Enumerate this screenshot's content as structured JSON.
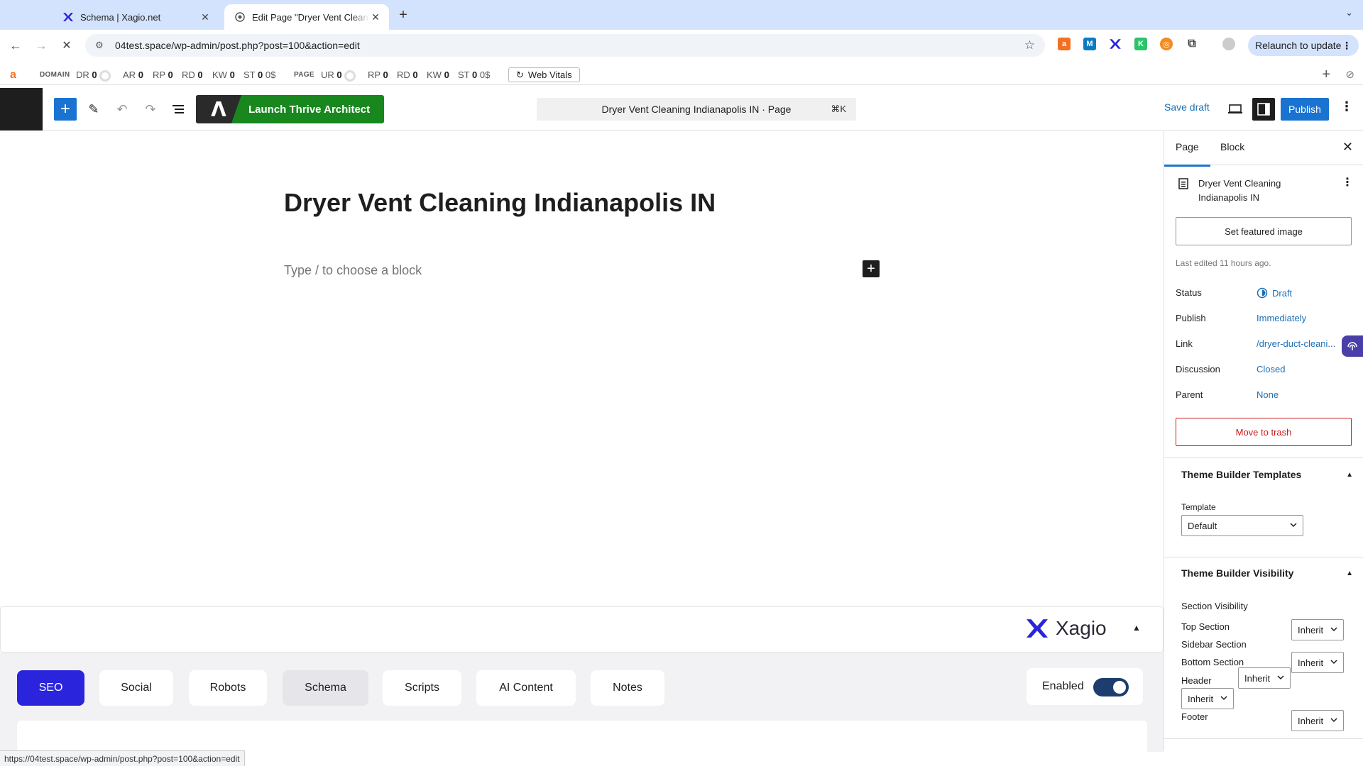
{
  "browser": {
    "tabs": [
      {
        "title": "Schema | Xagio.net",
        "active": false
      },
      {
        "title": "Edit Page \"Dryer Vent Cleaning Indianapolis IN\"",
        "active": true
      }
    ],
    "url": "04test.space/wp-admin/post.php?post=100&action=edit",
    "relaunch_label": "Relaunch to update",
    "status_url": "https://04test.space/wp-admin/post.php?post=100&action=edit"
  },
  "seobar": {
    "domain_label": "DOMAIN",
    "domain_metrics": [
      {
        "k": "DR",
        "v": "0"
      },
      {
        "k": "AR",
        "v": "0"
      },
      {
        "k": "RP",
        "v": "0"
      },
      {
        "k": "RD",
        "v": "0"
      },
      {
        "k": "KW",
        "v": "0"
      },
      {
        "k": "ST",
        "v": "0"
      },
      {
        "k": "",
        "v": "0$"
      }
    ],
    "page_label": "PAGE",
    "page_metrics": [
      {
        "k": "UR",
        "v": "0"
      },
      {
        "k": "RP",
        "v": "0"
      },
      {
        "k": "RD",
        "v": "0"
      },
      {
        "k": "KW",
        "v": "0"
      },
      {
        "k": "ST",
        "v": "0"
      },
      {
        "k": "",
        "v": "0$"
      }
    ],
    "web_vitals": "Web Vitals"
  },
  "editor": {
    "launch_thrive": "Launch Thrive Architect",
    "doc_title": "Dryer Vent Cleaning Indianapolis IN · Page",
    "shortcut": "⌘K",
    "save_draft": "Save draft",
    "publish": "Publish"
  },
  "content": {
    "title": "Dryer Vent Cleaning Indianapolis IN",
    "placeholder": "Type / to choose a block"
  },
  "xagio": {
    "brand": "Xagio",
    "tabs": [
      "SEO",
      "Social",
      "Robots",
      "Schema",
      "Scripts",
      "AI Content",
      "Notes"
    ],
    "selected_tab": "SEO",
    "enabled_label": "Enabled",
    "enabled": true,
    "accent": "#2a24dc"
  },
  "sidebar": {
    "tabs": [
      "Page",
      "Block"
    ],
    "page_name": "Dryer Vent Cleaning Indianapolis IN",
    "featured_image": "Set featured image",
    "last_edited": "Last edited 11 hours ago.",
    "props": [
      {
        "k": "Status",
        "v": "Draft"
      },
      {
        "k": "Publish",
        "v": "Immediately"
      },
      {
        "k": "Link",
        "v": "/dryer-duct-cleani..."
      },
      {
        "k": "Discussion",
        "v": "Closed"
      },
      {
        "k": "Parent",
        "v": "None"
      }
    ],
    "trash": "Move to trash",
    "theme_templates": {
      "heading": "Theme Builder Templates",
      "template_label": "Template",
      "template_value": "Default"
    },
    "theme_visibility": {
      "heading": "Theme Builder Visibility",
      "section_label": "Section Visibility",
      "top": "Top Section",
      "sidebar": "Sidebar Section",
      "bottom": "Bottom Section",
      "header": "Header",
      "footer": "Footer",
      "inherit": "Inherit"
    }
  }
}
